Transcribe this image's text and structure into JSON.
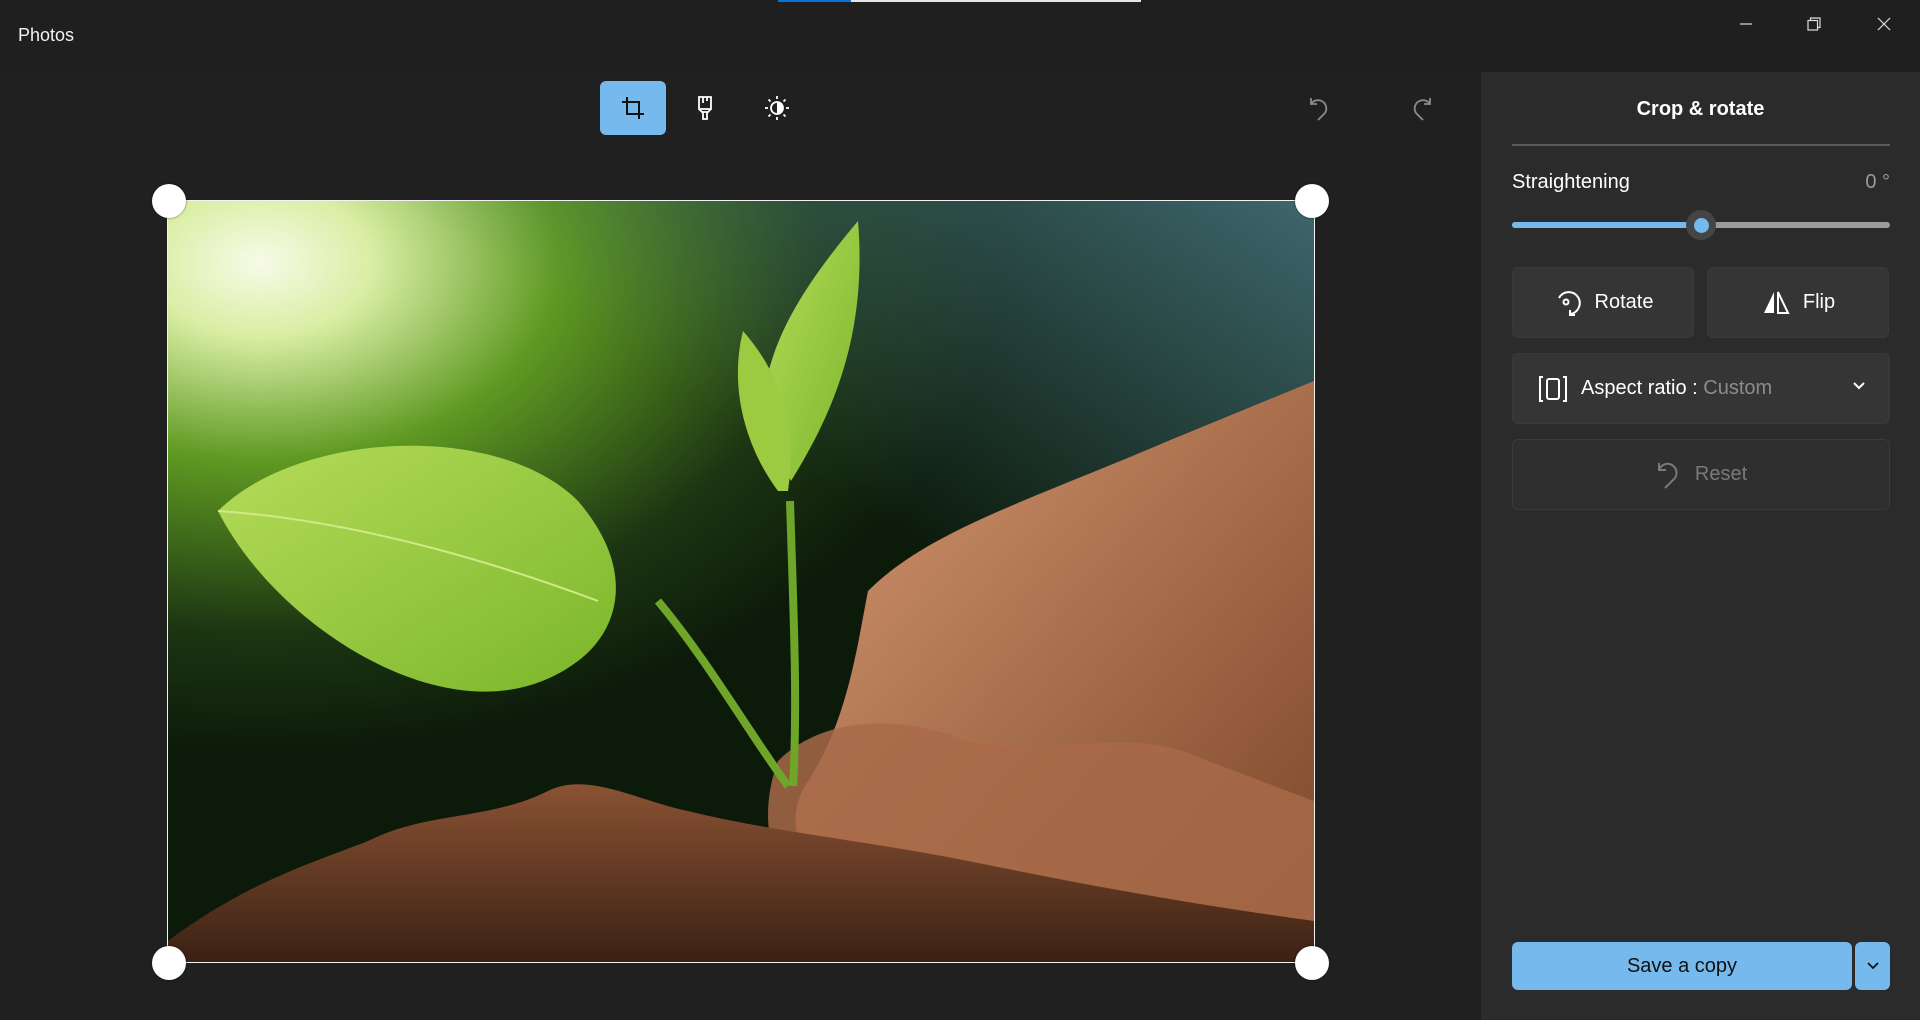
{
  "window": {
    "title": "Photos",
    "loading_progress_percent": 20,
    "controls": {
      "minimize": "minimize-icon",
      "restore": "restore-icon",
      "close": "close-icon"
    }
  },
  "toolbar": {
    "tabs": [
      {
        "id": "crop",
        "icon": "crop-icon",
        "active": true
      },
      {
        "id": "filter",
        "icon": "paintbrush-icon",
        "active": false
      },
      {
        "id": "adjust",
        "icon": "brightness-icon",
        "active": false
      }
    ],
    "undo_icon": "undo-icon",
    "redo_icon": "redo-icon"
  },
  "image": {
    "description": "Seedling with green leaves held by adult and child hands in soil, sunlight in background"
  },
  "panel": {
    "title": "Crop & rotate",
    "straightening": {
      "label": "Straightening",
      "value": "0 °",
      "degrees": 0,
      "min": -45,
      "max": 45
    },
    "rotate_label": "Rotate",
    "flip_label": "Flip",
    "aspect_ratio": {
      "label": "Aspect ratio : ",
      "value": "Custom"
    },
    "reset_label": "Reset",
    "save_label": "Save a copy"
  },
  "colors": {
    "accent": "#76b9ed",
    "progress": "#0a74d6",
    "panel_bg": "#2b2b2b",
    "app_bg": "#202020"
  }
}
